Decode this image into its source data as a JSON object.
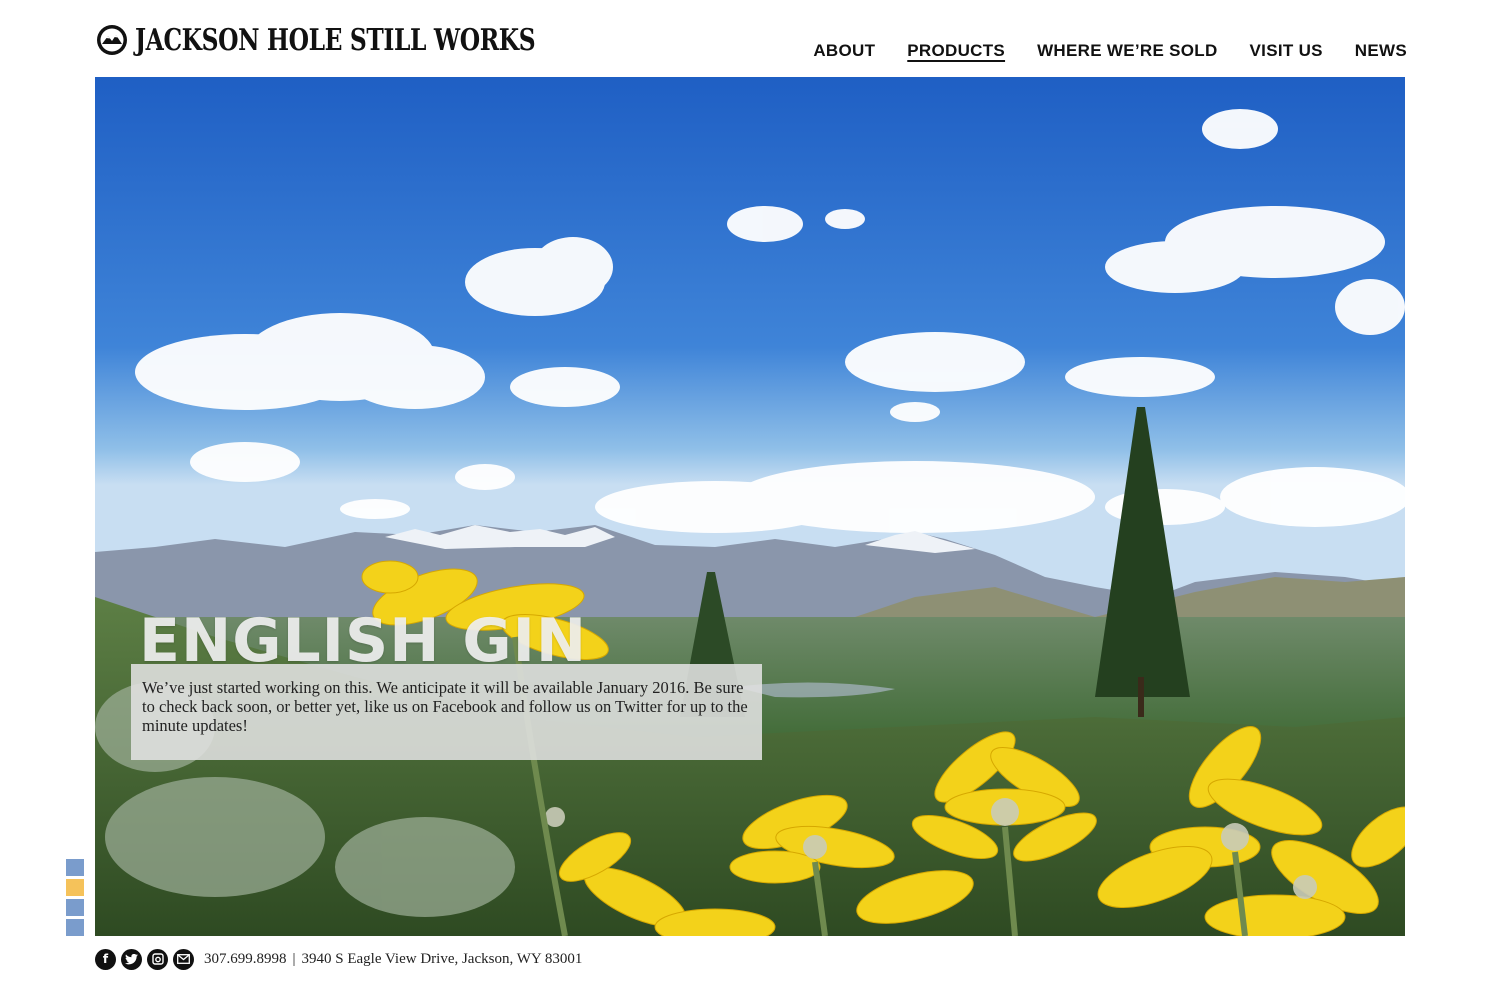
{
  "brand": {
    "name": "JACKSON HOLE STILL WORKS"
  },
  "nav": {
    "items": [
      {
        "label": "ABOUT",
        "active": false
      },
      {
        "label": "PRODUCTS",
        "active": true
      },
      {
        "label": "WHERE WE’RE SOLD",
        "active": false
      },
      {
        "label": "VISIT US",
        "active": false
      },
      {
        "label": "NEWS",
        "active": false
      }
    ]
  },
  "hero": {
    "title": "ENGLISH GIN",
    "description": "We’ve just started working on this. We anticipate it will be available January 2016. Be sure to check back soon, or better yet, like us on Facebook and follow us on Twitter for up to the minute updates!"
  },
  "pager": {
    "count": 4,
    "active_index": 1,
    "colors": {
      "inactive": "#7a9ccc",
      "active": "#f5c25a"
    }
  },
  "footer": {
    "social": [
      "facebook-icon",
      "twitter-icon",
      "instagram-icon",
      "email-icon"
    ],
    "phone": "307.699.8998",
    "separator": "|",
    "address": "3940 S Eagle View Drive,  Jackson, WY 83001"
  }
}
